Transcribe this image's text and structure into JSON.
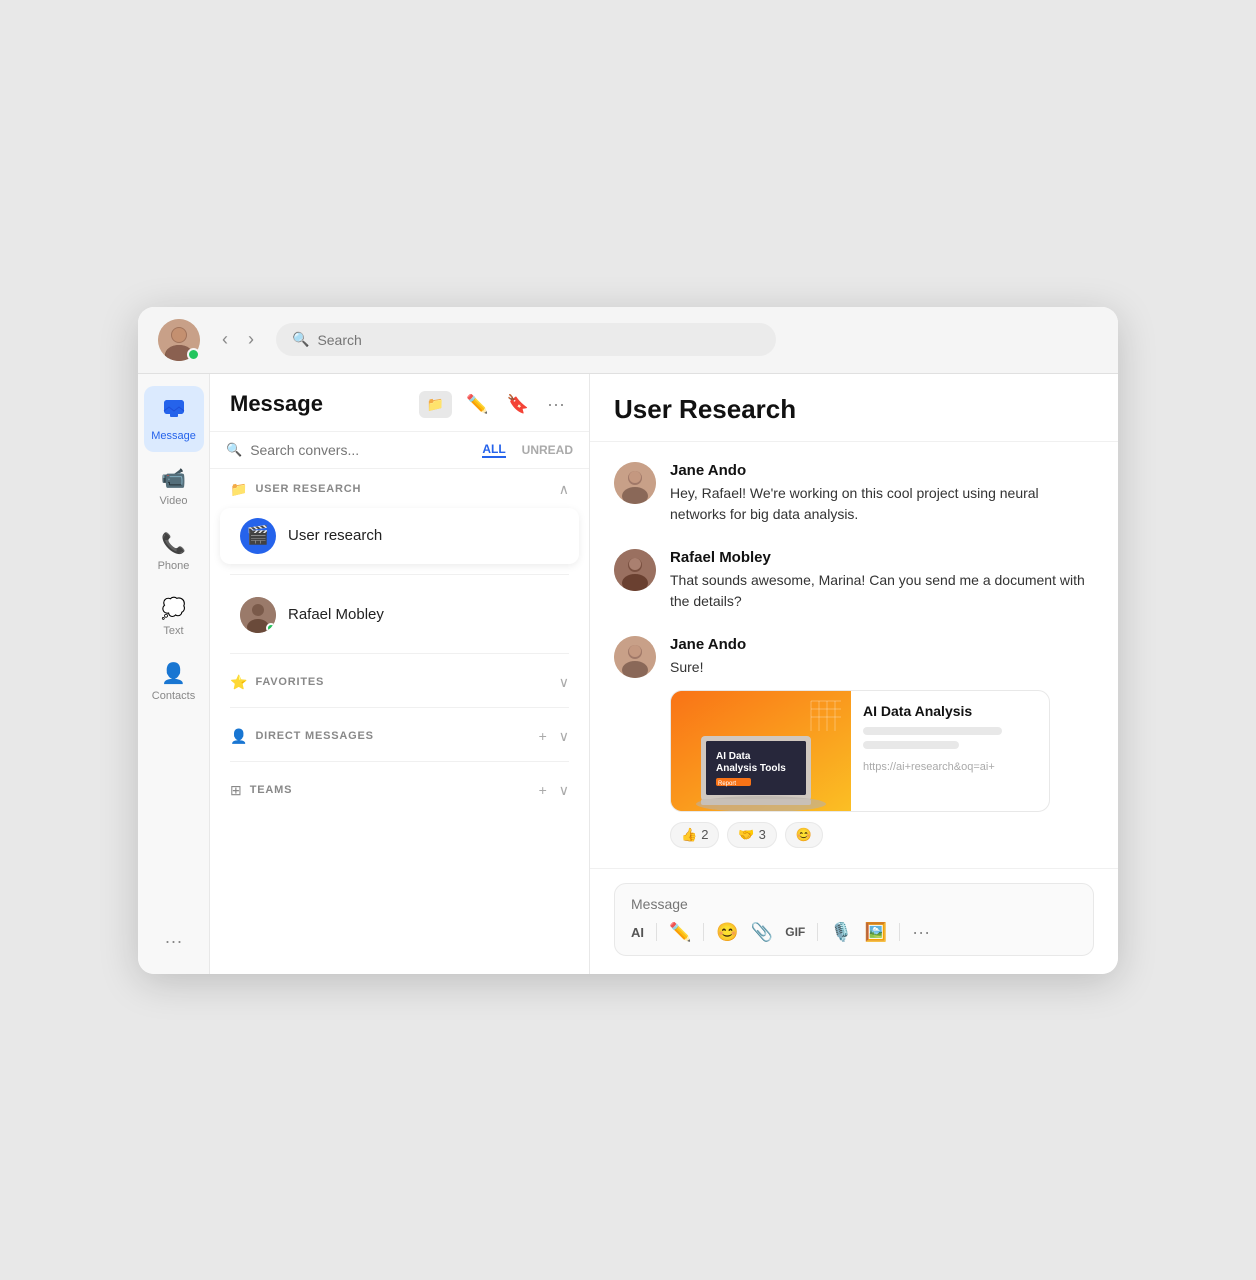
{
  "titlebar": {
    "search_placeholder": "Search",
    "nav_back": "‹",
    "nav_forward": "›"
  },
  "nav": {
    "items": [
      {
        "id": "message",
        "label": "Message",
        "icon": "💬",
        "active": true
      },
      {
        "id": "video",
        "label": "Video",
        "icon": "📹",
        "active": false
      },
      {
        "id": "phone",
        "label": "Phone",
        "icon": "📞",
        "active": false
      },
      {
        "id": "text",
        "label": "Text",
        "icon": "💭",
        "active": false
      },
      {
        "id": "contacts",
        "label": "Contacts",
        "icon": "👤",
        "active": false
      }
    ],
    "more": "···"
  },
  "message_panel": {
    "title": "Message",
    "folder_btn": "📁",
    "icons": [
      "✏️",
      "🔖",
      "···"
    ],
    "search_placeholder": "Search convers...",
    "filter_tabs": [
      {
        "label": "ALL",
        "active": true
      },
      {
        "label": "UNREAD",
        "active": false
      }
    ],
    "groups": [
      {
        "icon": "📁",
        "label": "USER RESEARCH",
        "chevron": "∧",
        "items": [
          {
            "name": "User research",
            "avatar_type": "icon",
            "icon": "🎬",
            "active": true
          }
        ]
      },
      {
        "label": "separator",
        "items": [
          {
            "name": "Rafael Mobley",
            "avatar_type": "photo",
            "color": "#8a6a5a",
            "active": false
          }
        ]
      },
      {
        "icon": "⭐",
        "label": "FAVORITES",
        "chevron": "∨",
        "items": []
      },
      {
        "icon": "👤",
        "label": "DIRECT MESSAGES",
        "chevron": "∨",
        "add": "+",
        "items": []
      },
      {
        "icon": "⊞",
        "label": "TEAMS",
        "chevron": "∨",
        "add": "+",
        "items": []
      }
    ]
  },
  "chat": {
    "title": "User Research",
    "messages": [
      {
        "sender": "Jane Ando",
        "avatar_color": "#c8a88a",
        "text": "Hey, Rafael! We're working on this cool project using neural networks for big data analysis.",
        "has_link": false
      },
      {
        "sender": "Rafael Mobley",
        "avatar_color": "#7a5a4a",
        "text": "That sounds awesome, Marina! Can you send me a document with the details?",
        "has_link": false
      },
      {
        "sender": "Jane Ando",
        "avatar_color": "#c8a88a",
        "text": "Sure!",
        "has_link": true,
        "link": {
          "title": "AI Data Analysis",
          "bar1_width": "80%",
          "bar2_width": "55%",
          "url": "https://ai+research&oq=ai+"
        },
        "reactions": [
          {
            "emoji": "👍",
            "count": "2"
          },
          {
            "emoji": "🤝",
            "count": "3"
          },
          {
            "emoji": "😊",
            "count": ""
          }
        ]
      }
    ],
    "input": {
      "placeholder": "Message",
      "tools": [
        "AI",
        "✏️",
        "😊",
        "📎",
        "GIF",
        "🎙️",
        "🖼️",
        "···"
      ]
    }
  }
}
